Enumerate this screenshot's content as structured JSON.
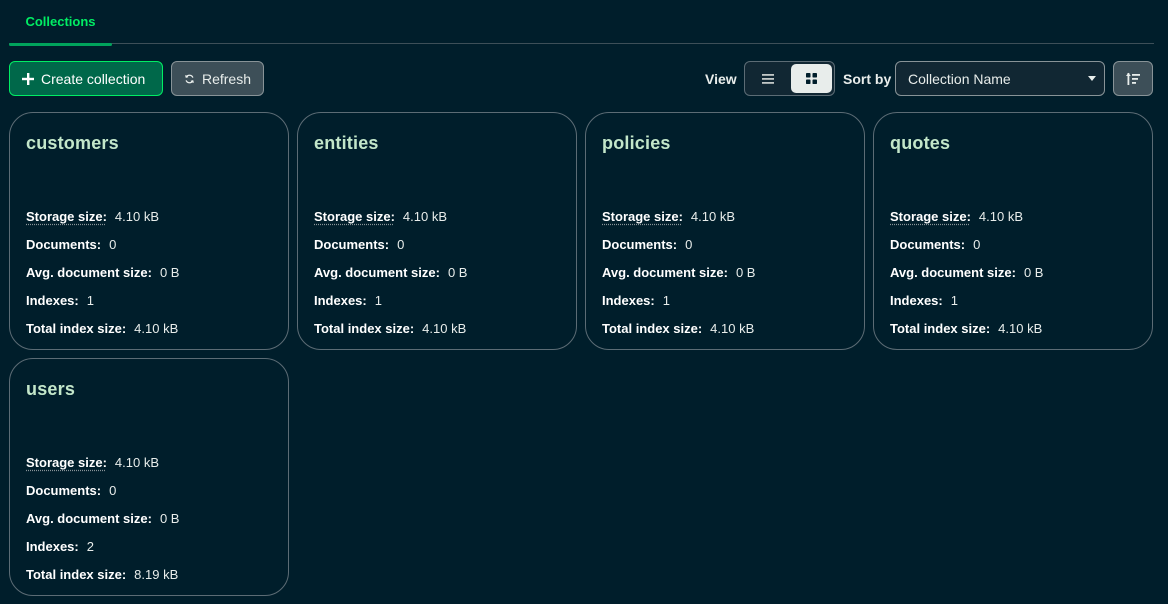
{
  "tabs": {
    "active_label": "Collections"
  },
  "toolbar": {
    "create_label": "Create collection",
    "refresh_label": "Refresh",
    "view_label": "View",
    "sort_label": "Sort by",
    "sort_value": "Collection Name"
  },
  "stat_labels": {
    "storage": "Storage size:",
    "documents": "Documents:",
    "avg": "Avg. document size:",
    "indexes": "Indexes:",
    "total_index": "Total index size:"
  },
  "collections": [
    {
      "name": "customers",
      "storage": "4.10 kB",
      "documents": "0",
      "avg": "0 B",
      "indexes": "1",
      "total_index": "4.10 kB"
    },
    {
      "name": "entities",
      "storage": "4.10 kB",
      "documents": "0",
      "avg": "0 B",
      "indexes": "1",
      "total_index": "4.10 kB"
    },
    {
      "name": "policies",
      "storage": "4.10 kB",
      "documents": "0",
      "avg": "0 B",
      "indexes": "1",
      "total_index": "4.10 kB"
    },
    {
      "name": "quotes",
      "storage": "4.10 kB",
      "documents": "0",
      "avg": "0 B",
      "indexes": "1",
      "total_index": "4.10 kB"
    },
    {
      "name": "users",
      "storage": "4.10 kB",
      "documents": "0",
      "avg": "0 B",
      "indexes": "2",
      "total_index": "8.19 kB"
    }
  ],
  "colors": {
    "background": "#001e2b",
    "accent": "#00ed64",
    "card_title": "#c3e7ca",
    "primary_button": "#00684a"
  },
  "icons": {
    "create": "plus-icon",
    "refresh": "refresh-icon",
    "list_view": "list-view-icon",
    "grid_view": "grid-view-icon",
    "sort_direction": "sort-ascending-icon"
  }
}
